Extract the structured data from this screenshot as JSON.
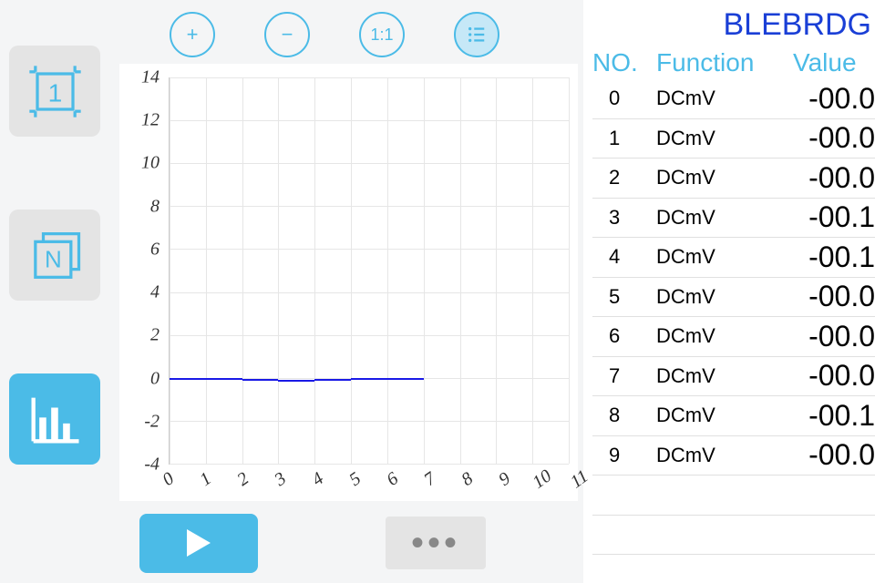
{
  "sidebar": {
    "btn1_label": "1",
    "btn2_label": "N"
  },
  "tools": {
    "plus": "+",
    "minus": "−",
    "onetoone": "1:1"
  },
  "device_title": "BLEBRDG",
  "columns": {
    "no": "NO.",
    "function": "Function",
    "value": "Value"
  },
  "rows": [
    {
      "no": "0",
      "fn": "DCmV",
      "val": "-00.0"
    },
    {
      "no": "1",
      "fn": "DCmV",
      "val": "-00.0"
    },
    {
      "no": "2",
      "fn": "DCmV",
      "val": "-00.0"
    },
    {
      "no": "3",
      "fn": "DCmV",
      "val": "-00.1"
    },
    {
      "no": "4",
      "fn": "DCmV",
      "val": "-00.1"
    },
    {
      "no": "5",
      "fn": "DCmV",
      "val": "-00.0"
    },
    {
      "no": "6",
      "fn": "DCmV",
      "val": "-00.0"
    },
    {
      "no": "7",
      "fn": "DCmV",
      "val": "-00.0"
    },
    {
      "no": "8",
      "fn": "DCmV",
      "val": "-00.1"
    },
    {
      "no": "9",
      "fn": "DCmV",
      "val": "-00.0"
    }
  ],
  "chart_data": {
    "type": "line",
    "x": [
      0,
      1,
      2,
      3,
      4,
      5,
      6,
      7
    ],
    "y": [
      0,
      0,
      0,
      -0.1,
      -0.1,
      0,
      0,
      0
    ],
    "xlim": [
      0,
      11
    ],
    "ylim": [
      -4,
      14
    ],
    "xticks": [
      0,
      1,
      2,
      3,
      4,
      5,
      6,
      7,
      8,
      9,
      10,
      11
    ],
    "yticks": [
      -4,
      -2,
      0,
      2,
      4,
      6,
      8,
      10,
      12,
      14
    ]
  }
}
